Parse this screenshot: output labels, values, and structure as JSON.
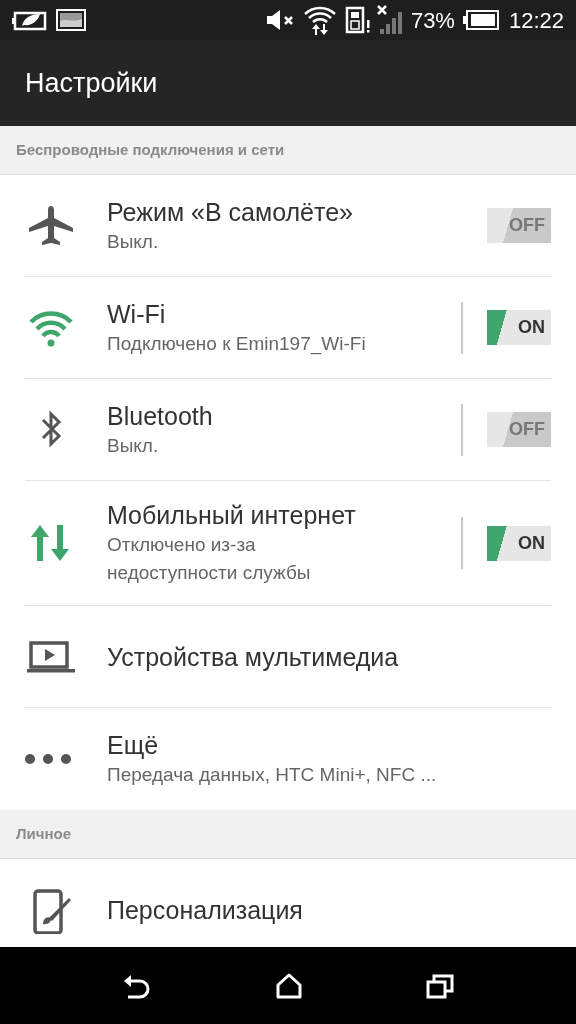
{
  "status_bar": {
    "battery_percent": "73%",
    "time": "12:22"
  },
  "header": {
    "title": "Настройки"
  },
  "sections": [
    {
      "title": "Беспроводные подключения и сети",
      "items": [
        {
          "kind": "toggle",
          "title": "Режим «В самолёте»",
          "subtitle": [
            "Выкл."
          ],
          "on": false,
          "label": "OFF",
          "separated": false
        },
        {
          "kind": "toggle",
          "title": "Wi-Fi",
          "subtitle": [
            "Подключено к Emin197_Wi-Fi"
          ],
          "on": true,
          "label": "ON",
          "separated": true
        },
        {
          "kind": "toggle",
          "title": "Bluetooth",
          "subtitle": [
            "Выкл."
          ],
          "on": false,
          "label": "OFF",
          "separated": true
        },
        {
          "kind": "toggle",
          "title": "Мобильный интернет",
          "subtitle": [
            "Отключено из-за",
            "недоступности службы"
          ],
          "on": true,
          "label": "ON",
          "separated": true
        },
        {
          "kind": "plain",
          "title": "Устройства мультимедиа"
        },
        {
          "kind": "plain",
          "title": "Ещё",
          "subtitle": [
            "Передача данных, HTC Mini+, NFC ..."
          ]
        }
      ]
    },
    {
      "title": "Личное",
      "items": [
        {
          "kind": "plain",
          "title": "Персонализация"
        }
      ]
    }
  ]
}
